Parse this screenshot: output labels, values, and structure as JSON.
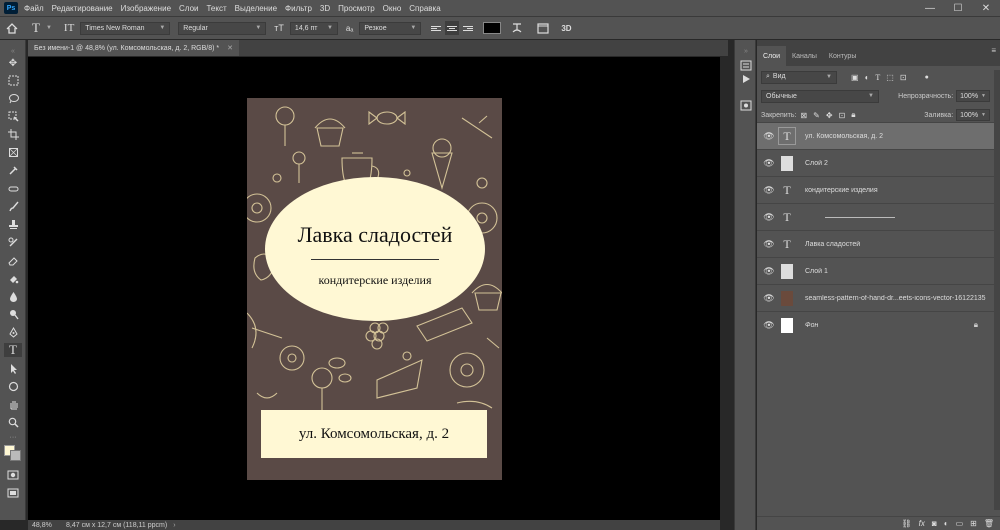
{
  "app": {
    "logo": "Ps"
  },
  "menubar": {
    "items": [
      "Файл",
      "Редактирование",
      "Изображение",
      "Слои",
      "Текст",
      "Выделение",
      "Фильтр",
      "3D",
      "Просмотр",
      "Окно",
      "Справка"
    ]
  },
  "window_controls": {
    "minimize": "—",
    "maximize": "☐",
    "close": "✕"
  },
  "options_bar": {
    "tool_glyph": "T",
    "font_family": "Times New Roman",
    "font_style": "Regular",
    "font_size": "14,6 пт",
    "aa_label": "aₐ",
    "antialias": "Резкое",
    "color_hex": "#000000",
    "three_d": "3D"
  },
  "document": {
    "tab_title": "Без имени-1 @ 48,8% (ул. Комсомольская, д. 2, RGB/8) *",
    "title": "Лавка сладостей",
    "subtitle": "кондитерские изделия",
    "address": "ул. Комсомольская, д. 2",
    "colors": {
      "background": "#5a4a46",
      "label": "#fff8d4",
      "pattern": "#e9d8a6"
    }
  },
  "status": {
    "zoom": "48,8%",
    "size": "8,47 см x 12,7 см (118,11 ppcm)"
  },
  "panel": {
    "tabs": [
      "Слои",
      "Каналы",
      "Контуры"
    ],
    "filter": "Вид",
    "blend_mode": "Обычные",
    "opacity_label": "Непрозрачность:",
    "opacity": "100%",
    "lock_label": "Закрепить:",
    "fill_label": "Заливка:",
    "fill": "100%",
    "layers": [
      {
        "name": "ул. Комсомольская, д. 2",
        "kind": "text",
        "selected": true
      },
      {
        "name": "Слой 2",
        "kind": "image"
      },
      {
        "name": "кондитерские изделия",
        "kind": "text"
      },
      {
        "name": "",
        "kind": "text-line"
      },
      {
        "name": "Лавка сладостей",
        "kind": "text"
      },
      {
        "name": "Слой 1",
        "kind": "image"
      },
      {
        "name": "seamless-pattern-of-hand-dr...eets-icons-vector-16122135",
        "kind": "pattern"
      },
      {
        "name": "Фон",
        "kind": "background",
        "locked": true
      }
    ],
    "bottom_icons": [
      "link-icon",
      "fx-icon",
      "mask-icon",
      "adjustment-icon",
      "folder-icon",
      "new-layer-icon",
      "trash-icon"
    ]
  }
}
